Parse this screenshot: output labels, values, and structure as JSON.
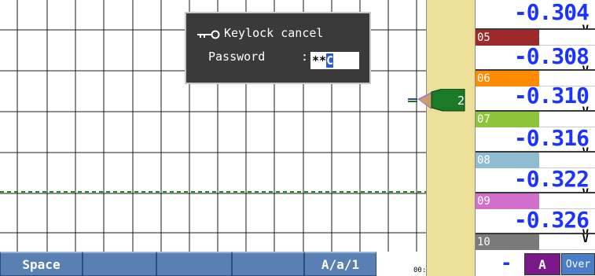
{
  "chart": {
    "grid_color": "#1a1a1a",
    "trace_color": "#1a8a1a",
    "trace_style": "dashed"
  },
  "marker": {
    "label": "2",
    "color": "#1a7a2a"
  },
  "dialog": {
    "title": "Keylock cancel",
    "password_label": "Password",
    "colon": ":",
    "password_masked": "**",
    "cursor_char": "C"
  },
  "channels": [
    {
      "value": "-0.304"
    },
    {
      "id": "05",
      "color": "#9c2a2a",
      "unit": "V",
      "value": "-0.308"
    },
    {
      "id": "06",
      "color": "#ff8c00",
      "unit": "V",
      "value": "-0.310"
    },
    {
      "id": "07",
      "color": "#8cc43a",
      "unit": "V",
      "value": "-0.316"
    },
    {
      "id": "08",
      "color": "#8fbcd0",
      "unit": "V",
      "value": "-0.322"
    },
    {
      "id": "09",
      "color": "#d070cc",
      "unit": "V",
      "value": "-0.326"
    },
    {
      "id": "10",
      "color": "#7a7a7a",
      "unit": "V",
      "value": "-"
    }
  ],
  "unit_top": "V",
  "softkeys": [
    "Space",
    "",
    "",
    "",
    "A/a/1"
  ],
  "status_tiny": "00:",
  "indicators": {
    "mode": "A",
    "over": "Over"
  }
}
